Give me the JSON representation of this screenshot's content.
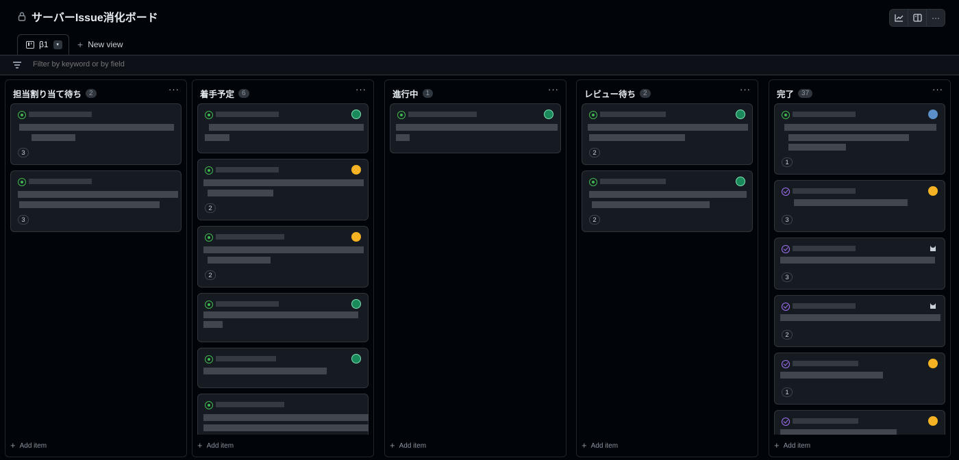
{
  "header": {
    "title": "サーバーIssue消化ボード",
    "icons": {
      "lock": "lock-icon",
      "insights": "graph-icon",
      "layout": "sidebar-icon",
      "more": "kebab-icon"
    },
    "more_label": "···"
  },
  "tabs": {
    "active_label": "β1",
    "caret": "▾",
    "new_view_plus": "+",
    "new_view_label": "New view"
  },
  "filter": {
    "placeholder": "Filter by keyword or by field"
  },
  "colors": {
    "open": "#3fb950",
    "done": "#a371f7",
    "background": "#010409",
    "card": "#161b22"
  },
  "columns": [
    {
      "title": "担当割り当て待ち",
      "count": "2",
      "menu": "···",
      "add_item": "Add item",
      "add_plus": "+",
      "cards": [
        {
          "state": "open",
          "estimate": "3"
        },
        {
          "state": "open",
          "estimate": "3"
        }
      ]
    },
    {
      "title": "着手予定",
      "count": "6",
      "menu": "···",
      "add_item": "Add item",
      "add_plus": "+",
      "cards": [
        {
          "state": "open",
          "avatar": "green"
        },
        {
          "state": "open",
          "avatar": "yellow",
          "estimate": "2"
        },
        {
          "state": "open",
          "avatar": "yellow",
          "estimate": "2"
        },
        {
          "state": "open",
          "avatar": "green"
        },
        {
          "state": "open",
          "avatar": "green"
        },
        {
          "state": "open"
        }
      ]
    },
    {
      "title": "進行中",
      "count": "1",
      "menu": "···",
      "add_item": "Add item",
      "add_plus": "+",
      "cards": [
        {
          "state": "open",
          "avatar": "green"
        }
      ]
    },
    {
      "title": "レビュー待ち",
      "count": "2",
      "menu": "···",
      "add_item": "Add item",
      "add_plus": "+",
      "cards": [
        {
          "state": "open",
          "avatar": "green",
          "estimate": "2"
        },
        {
          "state": "open",
          "avatar": "green",
          "estimate": "2"
        }
      ]
    },
    {
      "title": "完了",
      "count": "37",
      "menu": "···",
      "add_item": "Add item",
      "add_plus": "+",
      "cards": [
        {
          "state": "done-open",
          "avatar": "blue",
          "estimate": "1"
        },
        {
          "state": "done",
          "avatar": "yellow",
          "estimate": "3"
        },
        {
          "state": "done",
          "avatar": "gray",
          "estimate": "3"
        },
        {
          "state": "done",
          "avatar": "gray",
          "estimate": "2"
        },
        {
          "state": "done",
          "avatar": "yellow",
          "estimate": "1"
        },
        {
          "state": "done",
          "avatar": "yellow"
        }
      ]
    }
  ]
}
